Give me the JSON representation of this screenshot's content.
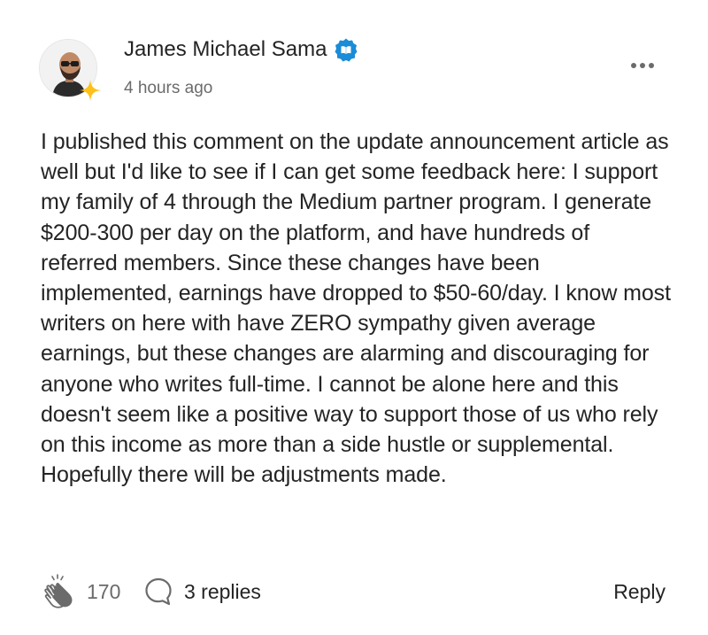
{
  "comment": {
    "author": {
      "name": "James Michael Sama",
      "verified": true,
      "avatar_icon": "profile-photo",
      "badge_icon": "sparkle-icon",
      "verified_icon": "verified-badge-icon"
    },
    "timestamp": "4 hours ago",
    "more_icon": "more-horizontal-icon",
    "body": "I published this comment on the update announcement article as well but I'd like to see if I can get some feedback here: I support my family of 4 through the Medium partner program. I generate $200-300 per day on the platform, and have hundreds of referred members. Since these changes have been implemented, earnings have dropped to $50-60/day. I know most writers on here with have ZERO sympathy given average earnings, but these changes are alarming and discouraging for anyone who writes full-time. I cannot be alone here and this doesn't seem like a positive way to support those of us who rely on this income as more than a side hustle or supplemental. Hopefully there will be adjustments made.",
    "footer": {
      "clap_count": "170",
      "replies_label": "3 replies",
      "reply_label": "Reply"
    }
  },
  "colors": {
    "text_primary": "#242424",
    "text_secondary": "#6b6b6b",
    "verified_blue": "#1A8CD8",
    "sparkle_gold": "#FFC017"
  }
}
